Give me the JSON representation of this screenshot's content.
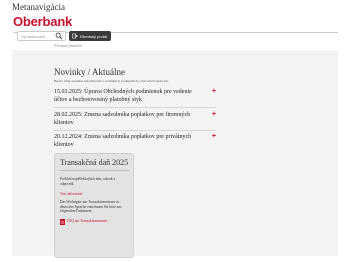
{
  "page": {
    "meta_title": "Metanavigácia"
  },
  "header": {
    "brand": "Oberbank",
    "search_placeholder": "Vyhľadávanie",
    "login_label": "Klientský portál",
    "accent_color": "#c8102e"
  },
  "breadcrumb": "Firemná finančia",
  "news": {
    "title": "Novinky / Aktuálne",
    "intro": "Buďte vždy aktuálne informovaní o novinkách, podujatiach a tlačových správach.",
    "items": [
      {
        "text": "15.03.2025: Úprava Obchodných podmienok pre vedenie účtov a bezhotovostný platobný styk"
      },
      {
        "text": "28.02.2025: Zmena sadzobníka poplatkov pre firemných klientov"
      },
      {
        "text": "20.12.2024: Zmena sadzobníka poplatkov pre privátnych klientov"
      }
    ]
  },
  "card": {
    "title": "Transakčná daň 2025",
    "description": "Prehľad najdôležitejších tém, otázok a odpovedí.",
    "link": "Viac informácií",
    "body": "Das Wichtigste zur Transaktionssteuer in deutscher Sprache entnehmen Sie bitte aus folgendem Dokument:",
    "faq": "FAQ zur Transaktionssteuer"
  }
}
